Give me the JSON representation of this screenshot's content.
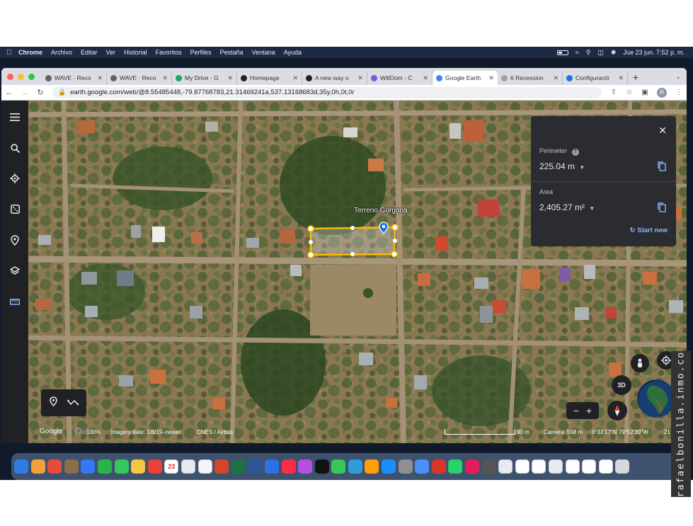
{
  "menubar": {
    "app": "Chrome",
    "items": [
      "Archivo",
      "Editar",
      "Ver",
      "Historial",
      "Favoritos",
      "Perfiles",
      "Pestaña",
      "Ventana",
      "Ayuda"
    ],
    "datetime": "Jue 23 jun.  7:52 p. m."
  },
  "tabs": [
    {
      "label": "WAVE · Reco",
      "color": "#5f6368"
    },
    {
      "label": "WAVE · Reco",
      "color": "#5f6368"
    },
    {
      "label": "My Drive - G",
      "color": "#1fa463"
    },
    {
      "label": "Homepage",
      "color": "#202124"
    },
    {
      "label": "A new way o",
      "color": "#202124"
    },
    {
      "label": "WillDom - C",
      "color": "#7b5cd6"
    },
    {
      "label": "Google Earth",
      "color": "#4285f4"
    },
    {
      "label": "6 Recession",
      "color": "#9aa0a6"
    },
    {
      "label": "Configuració",
      "color": "#1a73e8"
    }
  ],
  "address": {
    "url": "earth.google.com/web/@8.55485448,-79.87768783,21.31469241a,537.13168683d,35y,0h,0t,0r"
  },
  "profile_initial": "R",
  "placemark": {
    "label": "Terreno Gorgona"
  },
  "measure": {
    "perimeter_label": "Perimeter",
    "perimeter_value": "225.04 m",
    "area_label": "Area",
    "area_value": "2,405.27 m²",
    "start_new": "Start new"
  },
  "status": {
    "brand": "Google",
    "zoom": "100%",
    "imagery_date": "Imagery date: 1/8/19–newer",
    "credits": "CNES / Airbus",
    "scale": "90 m",
    "camera": "Camera: 558 m",
    "coords": "8°33'17\"N 79°52'39\"W",
    "elevation": "21"
  },
  "controls": {
    "view_3d": "3D"
  },
  "dock": {
    "calendar_day": "23",
    "colors": [
      "#2f7de1",
      "#f3a23a",
      "#e44c3c",
      "#8a6d4b",
      "#3478f6",
      "#2bb24c",
      "#34c759",
      "#f2c744",
      "#ea4335",
      "#ffffff",
      "#e8eaed",
      "#f5f5f5",
      "#d24726",
      "#1e7145",
      "#2b579a",
      "#2f6fe8",
      "#fa2d48",
      "#b150e2",
      "#111111",
      "#34c759",
      "#2d9cdb",
      "#ff9f0a",
      "#1c8ef9",
      "#8e8e93",
      "#4c8ef7",
      "#d9362b",
      "#25d366",
      "#e01e5a",
      "#555555",
      "#e8eaed",
      "#ffffff",
      "#ffffff",
      "#e8eaed",
      "#ffffff",
      "#ffffff",
      "#ffffff",
      "#d8d8d8"
    ]
  },
  "watermark": "rafaelbonilla.inmo.co",
  "colors": {
    "panel": "#2b2c2f",
    "accent": "#8ab4f8",
    "polygon": "#fbbc04",
    "pin": "#1a73e8"
  }
}
